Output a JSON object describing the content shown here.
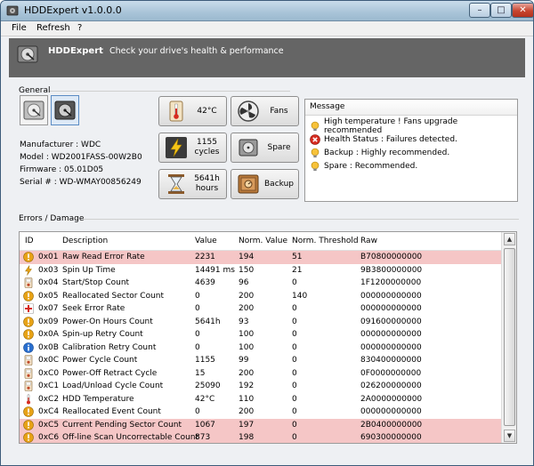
{
  "window": {
    "title": "HDDExpert v1.0.0.0",
    "minimize": "–",
    "maximize": "□",
    "close": "✕"
  },
  "menu": {
    "file": "File",
    "refresh": "Refresh",
    "help": "?"
  },
  "banner": {
    "title": "HDDExpert",
    "subtitle": "Check your drive's health & performance"
  },
  "general": {
    "label": "General",
    "manufacturer": "Manufacturer : WDC",
    "model": "Model : WD2001FASS-00W2B0",
    "firmware": "Firmware : 05.01D05",
    "serial": "Serial # : WD-WMAY00856249"
  },
  "stats": {
    "temperature": "42°C",
    "fans": "Fans",
    "cycles_value": "1155",
    "cycles_unit": "cycles",
    "spare": "Spare",
    "hours_value": "5641h",
    "hours_unit": "hours",
    "backup": "Backup"
  },
  "messages": {
    "header": "Message",
    "items": [
      {
        "icon": "warning-bulb",
        "text": "High temperature ! Fans upgrade recommended"
      },
      {
        "icon": "error-red-x",
        "text": "Health Status : Failures detected."
      },
      {
        "icon": "warning-bulb",
        "text": "Backup : Highly recommended."
      },
      {
        "icon": "warning-bulb",
        "text": "Spare : Recommended."
      }
    ]
  },
  "errors": {
    "label": "Errors / Damage",
    "columns": [
      "ID",
      "Description",
      "Value",
      "Norm. Value",
      "Norm. Threshold",
      "Raw"
    ],
    "rows": [
      {
        "id": "0x01",
        "desc": "Raw Read Error Rate",
        "value": "2231",
        "norm": "194",
        "thr": "51",
        "raw": "B70800000000",
        "icon": "warning",
        "highlight": true
      },
      {
        "id": "0x03",
        "desc": "Spin Up Time",
        "value": "14491 ms",
        "norm": "150",
        "thr": "21",
        "raw": "9B3800000000",
        "icon": "lightning",
        "highlight": false
      },
      {
        "id": "0x04",
        "desc": "Start/Stop Count",
        "value": "4639",
        "norm": "96",
        "thr": "0",
        "raw": "1F1200000000",
        "icon": "counter",
        "highlight": false
      },
      {
        "id": "0x05",
        "desc": "Reallocated Sector Count",
        "value": "0",
        "norm": "200",
        "thr": "140",
        "raw": "000000000000",
        "icon": "warning",
        "highlight": false
      },
      {
        "id": "0x07",
        "desc": "Seek Error Rate",
        "value": "0",
        "norm": "200",
        "thr": "0",
        "raw": "000000000000",
        "icon": "medic",
        "highlight": false
      },
      {
        "id": "0x09",
        "desc": "Power-On Hours Count",
        "value": "5641h",
        "norm": "93",
        "thr": "0",
        "raw": "091600000000",
        "icon": "warning",
        "highlight": false
      },
      {
        "id": "0x0A",
        "desc": "Spin-up Retry Count",
        "value": "0",
        "norm": "100",
        "thr": "0",
        "raw": "000000000000",
        "icon": "warning",
        "highlight": false
      },
      {
        "id": "0x0B",
        "desc": "Calibration Retry Count",
        "value": "0",
        "norm": "100",
        "thr": "0",
        "raw": "000000000000",
        "icon": "info",
        "highlight": false
      },
      {
        "id": "0x0C",
        "desc": "Power Cycle Count",
        "value": "1155",
        "norm": "99",
        "thr": "0",
        "raw": "830400000000",
        "icon": "counter",
        "highlight": false
      },
      {
        "id": "0xC0",
        "desc": "Power-Off Retract Cycle",
        "value": "15",
        "norm": "200",
        "thr": "0",
        "raw": "0F0000000000",
        "icon": "counter",
        "highlight": false
      },
      {
        "id": "0xC1",
        "desc": "Load/Unload Cycle Count",
        "value": "25090",
        "norm": "192",
        "thr": "0",
        "raw": "026200000000",
        "icon": "counter",
        "highlight": false
      },
      {
        "id": "0xC2",
        "desc": "HDD Temperature",
        "value": "42°C",
        "norm": "110",
        "thr": "0",
        "raw": "2A0000000000",
        "icon": "thermometer",
        "highlight": false
      },
      {
        "id": "0xC4",
        "desc": "Reallocated Event Count",
        "value": "0",
        "norm": "200",
        "thr": "0",
        "raw": "000000000000",
        "icon": "warning",
        "highlight": false
      },
      {
        "id": "0xC5",
        "desc": "Current Pending Sector Count",
        "value": "1067",
        "norm": "197",
        "thr": "0",
        "raw": "2B0400000000",
        "icon": "warning",
        "highlight": true
      },
      {
        "id": "0xC6",
        "desc": "Off-line Scan Uncorrectable Count",
        "value": "873",
        "norm": "198",
        "thr": "0",
        "raw": "690300000000",
        "icon": "warning",
        "highlight": true
      }
    ]
  },
  "colors": {
    "banner": "#656565",
    "highlight_row": "#f5c6c6",
    "accent_orange": "#e8a317",
    "error_red": "#d62b1f",
    "info_blue": "#2a6fcf"
  }
}
